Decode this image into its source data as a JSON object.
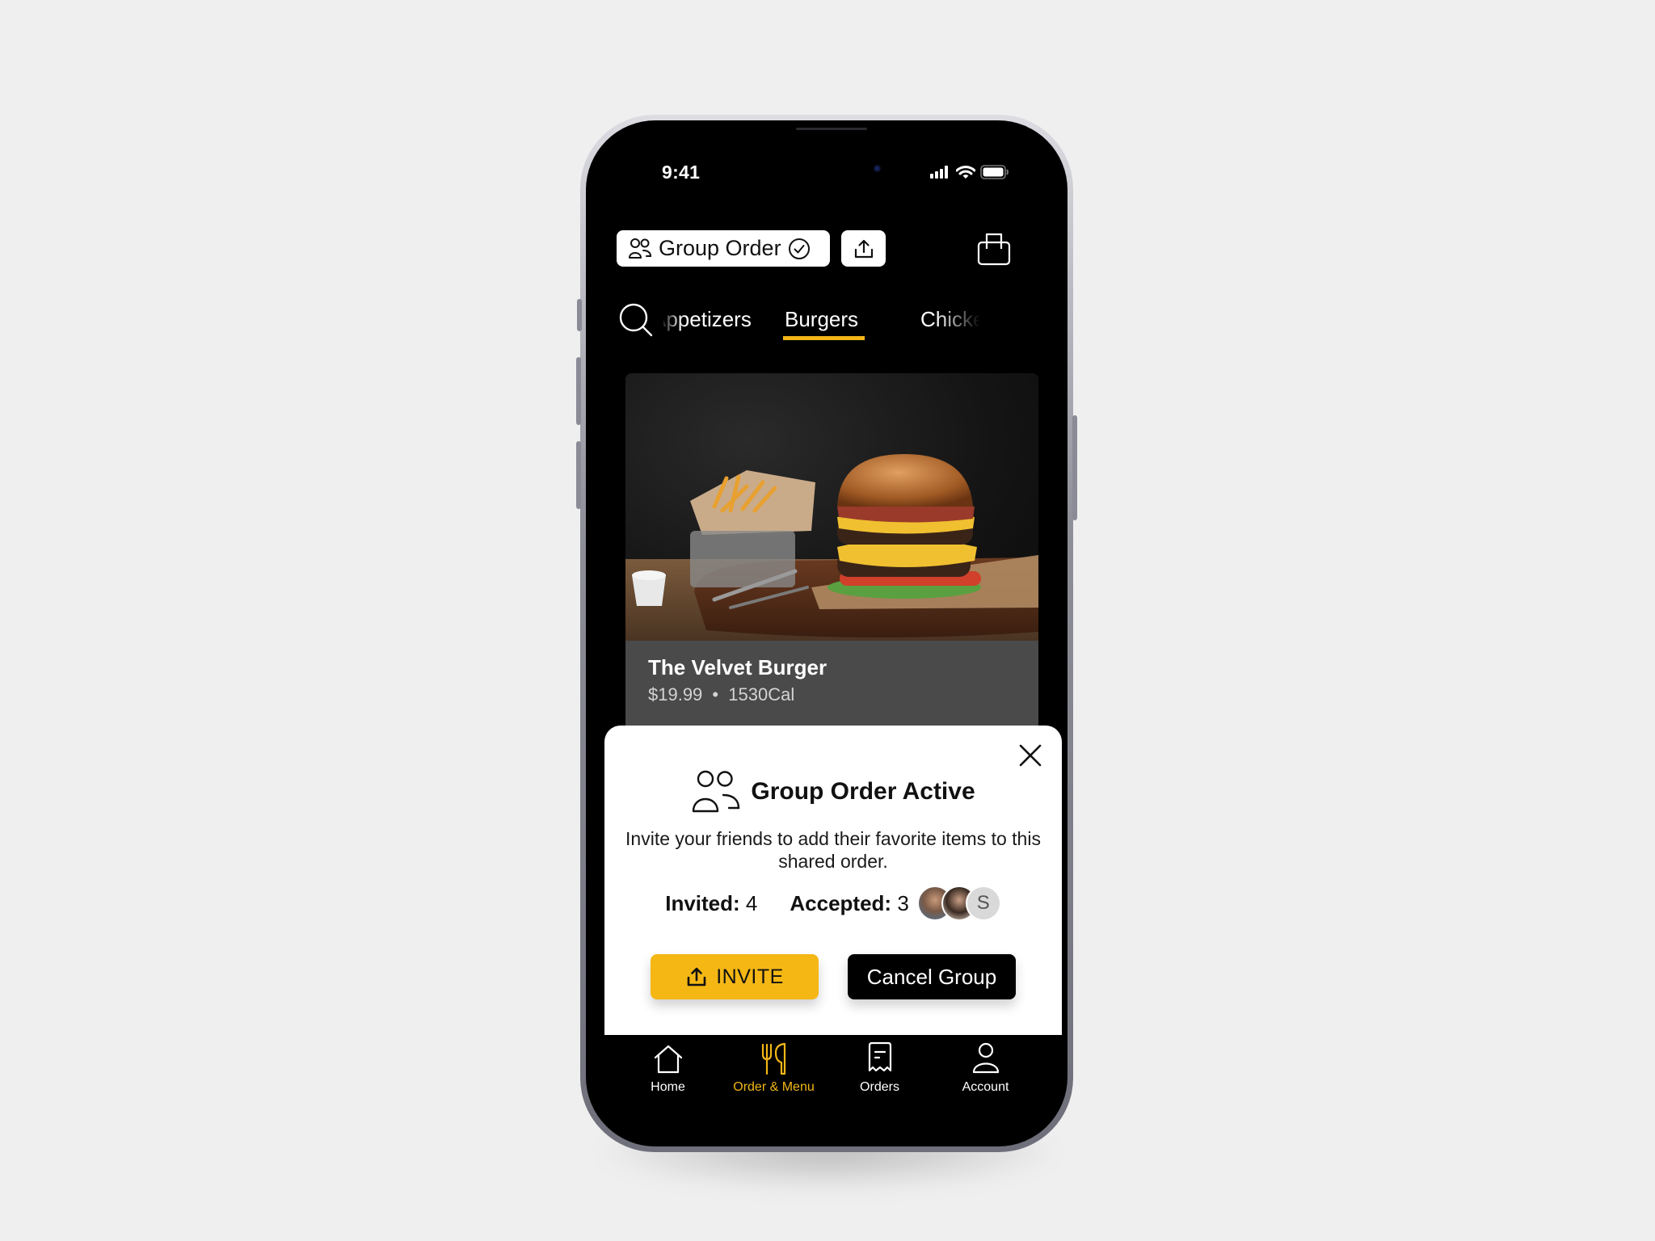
{
  "status_bar": {
    "time": "9:41",
    "icons": [
      "cellular-signal-icon",
      "wifi-icon",
      "battery-icon"
    ]
  },
  "header": {
    "group_order_label": "Group Order",
    "group_order_icons": [
      "people-icon",
      "check-circle-icon"
    ],
    "share_icon": "share-icon",
    "cart_icon": "shopping-bag-icon"
  },
  "categories": {
    "search_icon": "search-icon",
    "tabs": [
      {
        "label": "Appetizers",
        "visible_text": "etizers",
        "active": false
      },
      {
        "label": "Burgers",
        "active": true
      },
      {
        "label": "Chicken",
        "visible_text": "Chicke",
        "active": false
      }
    ],
    "active_color": "#F2B617"
  },
  "product": {
    "image": "burger-and-fries-photo",
    "name": "The Velvet Burger",
    "price": "$19.99",
    "separator": "•",
    "calories": "1530Cal"
  },
  "group_sheet": {
    "icon": "people-icon",
    "title": "Group Order Active",
    "description": "Invite your friends to add their favorite items to this shared order.",
    "invited_label": "Invited:",
    "invited_count": "4",
    "accepted_label": "Accepted:",
    "accepted_count": "3",
    "avatars": [
      {
        "type": "photo",
        "alt": "man-avatar"
      },
      {
        "type": "photo",
        "alt": "woman-avatar"
      },
      {
        "type": "initial",
        "initial": "S"
      }
    ],
    "invite_label": "INVITE",
    "invite_icon": "share-icon",
    "cancel_label": "Cancel Group",
    "close_icon": "close-icon",
    "accent_color": "#F4B714"
  },
  "bottom_nav": {
    "items": [
      {
        "label": "Home",
        "icon": "home-icon",
        "active": false
      },
      {
        "label": "Order & Menu",
        "icon": "fork-knife-icon",
        "active": true
      },
      {
        "label": "Orders",
        "icon": "receipt-icon",
        "active": false
      },
      {
        "label": "Account",
        "icon": "person-icon",
        "active": false
      }
    ]
  }
}
